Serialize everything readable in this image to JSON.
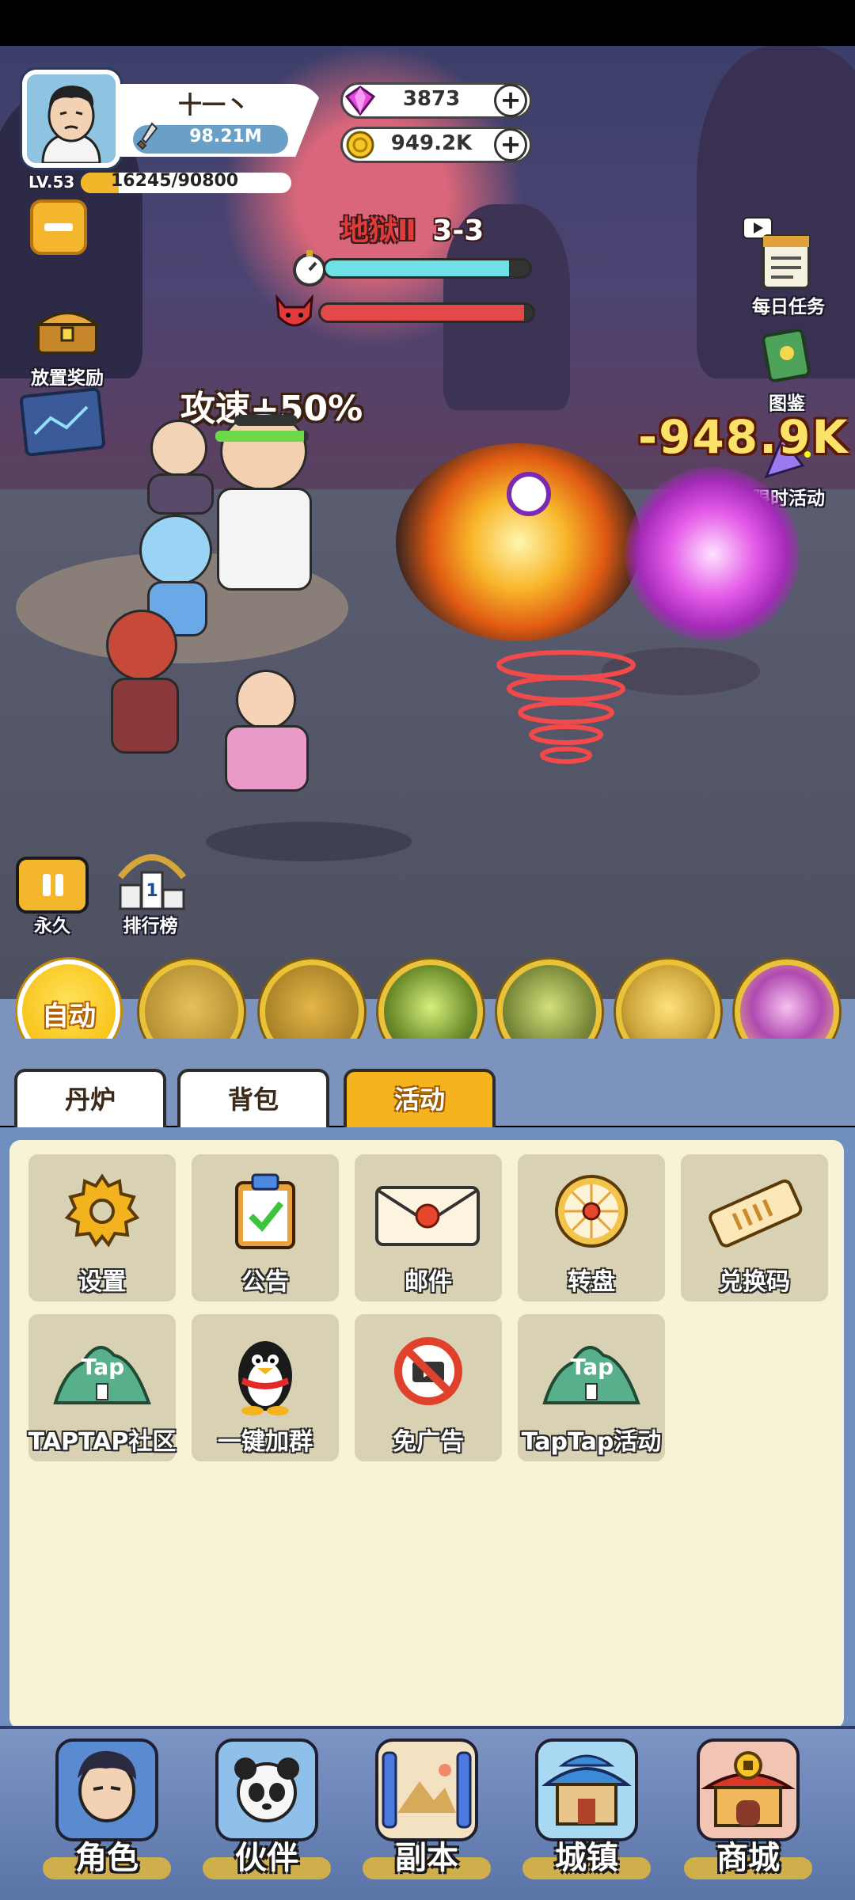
{
  "player": {
    "name": "十一丶",
    "power": "98.21M",
    "level": "LV.53",
    "xp": "16245/90800",
    "xp_progress": 0.179
  },
  "currency": {
    "gems": "3873",
    "coins": "949.2K"
  },
  "stage": {
    "difficulty": "地狱Ⅱ",
    "level": "3-3",
    "timer_progress": 0.9,
    "boss_hp_progress": 0.96
  },
  "side_buttons": {
    "idle_reward": "放置奖励",
    "daily_tasks": "每日任务",
    "codex": "图鉴",
    "limited_event": "限时活动",
    "permanent": "永久",
    "leaderboard": "排行榜"
  },
  "battle": {
    "buff_text": "攻速+50%",
    "damage_text": "-948.9K"
  },
  "skills": {
    "auto_label": "自动",
    "icons": [
      "boar-skill-icon",
      "strength-skill-icon",
      "fireball-skill-icon",
      "talisman-skill-icon",
      "tornado-skill-icon",
      "vortex-skill-icon"
    ]
  },
  "tabs": [
    {
      "label": "丹炉",
      "active": false
    },
    {
      "label": "背包",
      "active": false
    },
    {
      "label": "活动",
      "active": true
    }
  ],
  "tiles": [
    {
      "label": "设置",
      "icon": "gear-icon"
    },
    {
      "label": "公告",
      "icon": "clipboard-check-icon"
    },
    {
      "label": "邮件",
      "icon": "envelope-icon"
    },
    {
      "label": "转盘",
      "icon": "wheel-icon"
    },
    {
      "label": "兑换码",
      "icon": "ticket-icon"
    },
    {
      "label": "TAPTAP社区",
      "icon": "taptap-icon"
    },
    {
      "label": "一键加群",
      "icon": "qq-penguin-icon"
    },
    {
      "label": "免广告",
      "icon": "no-ads-icon"
    },
    {
      "label": "TapTap活动",
      "icon": "taptap-icon"
    }
  ],
  "nav": [
    {
      "label": "角色",
      "icon": "character-icon"
    },
    {
      "label": "伙伴",
      "icon": "partner-icon"
    },
    {
      "label": "副本",
      "icon": "dungeon-scroll-icon"
    },
    {
      "label": "城镇",
      "icon": "town-icon"
    },
    {
      "label": "商城",
      "icon": "shop-icon"
    }
  ],
  "colors": {
    "accent": "#f5b41e",
    "panel": "#f6f3d6",
    "nav": "#6f8ec0"
  }
}
